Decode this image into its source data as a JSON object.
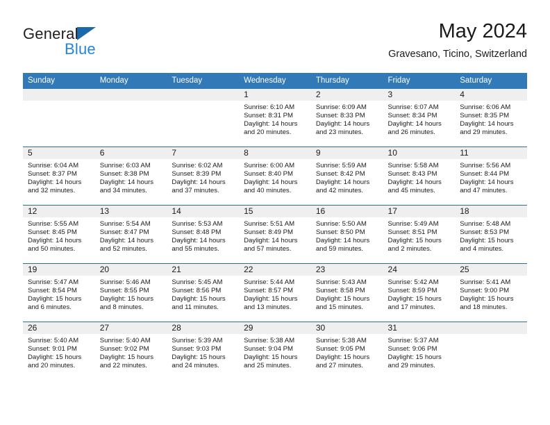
{
  "brand": {
    "name_top": "General",
    "name_bottom": "Blue",
    "accent_color": "#2585d3",
    "triangle_color": "#1a6aab"
  },
  "header": {
    "title": "May 2024",
    "subtitle": "Gravesano, Ticino, Switzerland"
  },
  "theme": {
    "header_bar_color": "#3279b7",
    "row_divider_color": "#2a6ea8",
    "daynum_strip_color": "#efefef"
  },
  "weekday_headers": [
    "Sunday",
    "Monday",
    "Tuesday",
    "Wednesday",
    "Thursday",
    "Friday",
    "Saturday"
  ],
  "labels": {
    "sunrise_prefix": "Sunrise:",
    "sunset_prefix": "Sunset:",
    "daylight_prefix": "Daylight:"
  },
  "weeks": [
    [
      {
        "day": "",
        "empty": true
      },
      {
        "day": "",
        "empty": true
      },
      {
        "day": "",
        "empty": true
      },
      {
        "day": "1",
        "sunrise": "Sunrise: 6:10 AM",
        "sunset": "Sunset: 8:31 PM",
        "daylight_line1": "Daylight: 14 hours",
        "daylight_line2": "and 20 minutes."
      },
      {
        "day": "2",
        "sunrise": "Sunrise: 6:09 AM",
        "sunset": "Sunset: 8:33 PM",
        "daylight_line1": "Daylight: 14 hours",
        "daylight_line2": "and 23 minutes."
      },
      {
        "day": "3",
        "sunrise": "Sunrise: 6:07 AM",
        "sunset": "Sunset: 8:34 PM",
        "daylight_line1": "Daylight: 14 hours",
        "daylight_line2": "and 26 minutes."
      },
      {
        "day": "4",
        "sunrise": "Sunrise: 6:06 AM",
        "sunset": "Sunset: 8:35 PM",
        "daylight_line1": "Daylight: 14 hours",
        "daylight_line2": "and 29 minutes."
      }
    ],
    [
      {
        "day": "5",
        "sunrise": "Sunrise: 6:04 AM",
        "sunset": "Sunset: 8:37 PM",
        "daylight_line1": "Daylight: 14 hours",
        "daylight_line2": "and 32 minutes."
      },
      {
        "day": "6",
        "sunrise": "Sunrise: 6:03 AM",
        "sunset": "Sunset: 8:38 PM",
        "daylight_line1": "Daylight: 14 hours",
        "daylight_line2": "and 34 minutes."
      },
      {
        "day": "7",
        "sunrise": "Sunrise: 6:02 AM",
        "sunset": "Sunset: 8:39 PM",
        "daylight_line1": "Daylight: 14 hours",
        "daylight_line2": "and 37 minutes."
      },
      {
        "day": "8",
        "sunrise": "Sunrise: 6:00 AM",
        "sunset": "Sunset: 8:40 PM",
        "daylight_line1": "Daylight: 14 hours",
        "daylight_line2": "and 40 minutes."
      },
      {
        "day": "9",
        "sunrise": "Sunrise: 5:59 AM",
        "sunset": "Sunset: 8:42 PM",
        "daylight_line1": "Daylight: 14 hours",
        "daylight_line2": "and 42 minutes."
      },
      {
        "day": "10",
        "sunrise": "Sunrise: 5:58 AM",
        "sunset": "Sunset: 8:43 PM",
        "daylight_line1": "Daylight: 14 hours",
        "daylight_line2": "and 45 minutes."
      },
      {
        "day": "11",
        "sunrise": "Sunrise: 5:56 AM",
        "sunset": "Sunset: 8:44 PM",
        "daylight_line1": "Daylight: 14 hours",
        "daylight_line2": "and 47 minutes."
      }
    ],
    [
      {
        "day": "12",
        "sunrise": "Sunrise: 5:55 AM",
        "sunset": "Sunset: 8:45 PM",
        "daylight_line1": "Daylight: 14 hours",
        "daylight_line2": "and 50 minutes."
      },
      {
        "day": "13",
        "sunrise": "Sunrise: 5:54 AM",
        "sunset": "Sunset: 8:47 PM",
        "daylight_line1": "Daylight: 14 hours",
        "daylight_line2": "and 52 minutes."
      },
      {
        "day": "14",
        "sunrise": "Sunrise: 5:53 AM",
        "sunset": "Sunset: 8:48 PM",
        "daylight_line1": "Daylight: 14 hours",
        "daylight_line2": "and 55 minutes."
      },
      {
        "day": "15",
        "sunrise": "Sunrise: 5:51 AM",
        "sunset": "Sunset: 8:49 PM",
        "daylight_line1": "Daylight: 14 hours",
        "daylight_line2": "and 57 minutes."
      },
      {
        "day": "16",
        "sunrise": "Sunrise: 5:50 AM",
        "sunset": "Sunset: 8:50 PM",
        "daylight_line1": "Daylight: 14 hours",
        "daylight_line2": "and 59 minutes."
      },
      {
        "day": "17",
        "sunrise": "Sunrise: 5:49 AM",
        "sunset": "Sunset: 8:51 PM",
        "daylight_line1": "Daylight: 15 hours",
        "daylight_line2": "and 2 minutes."
      },
      {
        "day": "18",
        "sunrise": "Sunrise: 5:48 AM",
        "sunset": "Sunset: 8:53 PM",
        "daylight_line1": "Daylight: 15 hours",
        "daylight_line2": "and 4 minutes."
      }
    ],
    [
      {
        "day": "19",
        "sunrise": "Sunrise: 5:47 AM",
        "sunset": "Sunset: 8:54 PM",
        "daylight_line1": "Daylight: 15 hours",
        "daylight_line2": "and 6 minutes."
      },
      {
        "day": "20",
        "sunrise": "Sunrise: 5:46 AM",
        "sunset": "Sunset: 8:55 PM",
        "daylight_line1": "Daylight: 15 hours",
        "daylight_line2": "and 8 minutes."
      },
      {
        "day": "21",
        "sunrise": "Sunrise: 5:45 AM",
        "sunset": "Sunset: 8:56 PM",
        "daylight_line1": "Daylight: 15 hours",
        "daylight_line2": "and 11 minutes."
      },
      {
        "day": "22",
        "sunrise": "Sunrise: 5:44 AM",
        "sunset": "Sunset: 8:57 PM",
        "daylight_line1": "Daylight: 15 hours",
        "daylight_line2": "and 13 minutes."
      },
      {
        "day": "23",
        "sunrise": "Sunrise: 5:43 AM",
        "sunset": "Sunset: 8:58 PM",
        "daylight_line1": "Daylight: 15 hours",
        "daylight_line2": "and 15 minutes."
      },
      {
        "day": "24",
        "sunrise": "Sunrise: 5:42 AM",
        "sunset": "Sunset: 8:59 PM",
        "daylight_line1": "Daylight: 15 hours",
        "daylight_line2": "and 17 minutes."
      },
      {
        "day": "25",
        "sunrise": "Sunrise: 5:41 AM",
        "sunset": "Sunset: 9:00 PM",
        "daylight_line1": "Daylight: 15 hours",
        "daylight_line2": "and 18 minutes."
      }
    ],
    [
      {
        "day": "26",
        "sunrise": "Sunrise: 5:40 AM",
        "sunset": "Sunset: 9:01 PM",
        "daylight_line1": "Daylight: 15 hours",
        "daylight_line2": "and 20 minutes."
      },
      {
        "day": "27",
        "sunrise": "Sunrise: 5:40 AM",
        "sunset": "Sunset: 9:02 PM",
        "daylight_line1": "Daylight: 15 hours",
        "daylight_line2": "and 22 minutes."
      },
      {
        "day": "28",
        "sunrise": "Sunrise: 5:39 AM",
        "sunset": "Sunset: 9:03 PM",
        "daylight_line1": "Daylight: 15 hours",
        "daylight_line2": "and 24 minutes."
      },
      {
        "day": "29",
        "sunrise": "Sunrise: 5:38 AM",
        "sunset": "Sunset: 9:04 PM",
        "daylight_line1": "Daylight: 15 hours",
        "daylight_line2": "and 25 minutes."
      },
      {
        "day": "30",
        "sunrise": "Sunrise: 5:38 AM",
        "sunset": "Sunset: 9:05 PM",
        "daylight_line1": "Daylight: 15 hours",
        "daylight_line2": "and 27 minutes."
      },
      {
        "day": "31",
        "sunrise": "Sunrise: 5:37 AM",
        "sunset": "Sunset: 9:06 PM",
        "daylight_line1": "Daylight: 15 hours",
        "daylight_line2": "and 29 minutes."
      },
      {
        "day": "",
        "empty": true
      }
    ]
  ]
}
